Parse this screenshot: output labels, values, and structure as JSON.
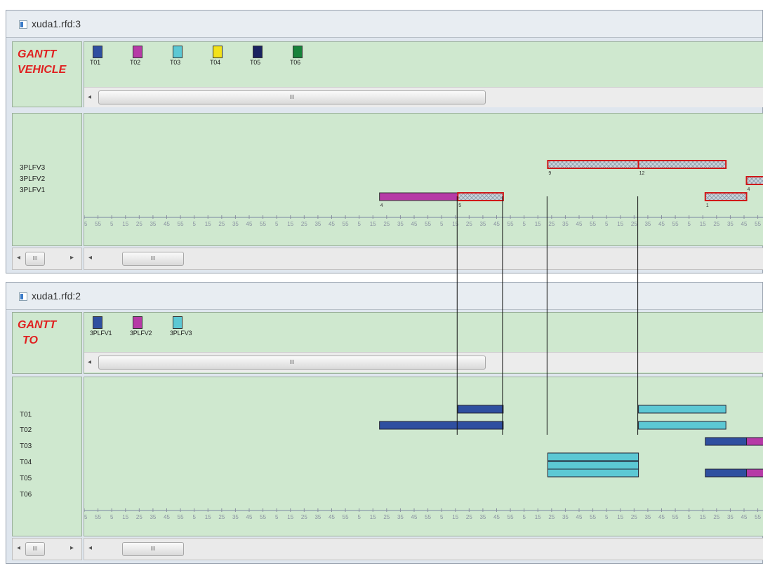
{
  "colors": {
    "T01": "#2f4fa0",
    "T02": "#b63aa6",
    "T03": "#5cc8d4",
    "T04": "#f2e21a",
    "T05": "#1a2260",
    "T06": "#17823a",
    "hatched_border": "#d01818",
    "hatched_fill": "#c9d4dc"
  },
  "top_window": {
    "title": "xuda1.rfd:3",
    "gantt_title_line1": "GANTT",
    "gantt_title_line2": "VEHICLE",
    "legend": [
      {
        "label": "T01",
        "color": "#2f4fa0"
      },
      {
        "label": "T02",
        "color": "#b63aa6"
      },
      {
        "label": "T03",
        "color": "#5cc8d4"
      },
      {
        "label": "T04",
        "color": "#f2e21a"
      },
      {
        "label": "T05",
        "color": "#1a2260"
      },
      {
        "label": "T06",
        "color": "#17823a"
      }
    ],
    "scroll_thumb_label": "III",
    "row_labels": [
      "3PLFV3",
      "3PLFV2",
      "3PLFV1"
    ]
  },
  "bottom_window": {
    "title": "xuda1.rfd:2",
    "gantt_title_line1": "GANTT",
    "gantt_title_line2": "TO",
    "legend": [
      {
        "label": "3PLFV1",
        "color": "#2f4fa0"
      },
      {
        "label": "3PLFV2",
        "color": "#b63aa6"
      },
      {
        "label": "3PLFV3",
        "color": "#5cc8d4"
      }
    ],
    "scroll_thumb_label": "III",
    "row_labels": [
      "T01",
      "T02",
      "T03",
      "T04",
      "T05",
      "T06"
    ]
  },
  "timeline": {
    "start_hour": 4.75,
    "end_hour": 13.0,
    "minute_ticks": [
      10,
      20,
      30,
      40,
      50
    ],
    "hours": [
      5,
      6,
      7,
      8,
      9,
      10,
      11,
      12
    ]
  },
  "vehicle_bars": [
    {
      "row": "3PLFV1",
      "start": 8.33,
      "end": 9.28,
      "style": "solid",
      "color": "#b63aa6",
      "num_start": "4",
      "num_end": "5",
      "hatch_from": 9.28
    },
    {
      "row": "3PLFV1",
      "start": 9.28,
      "end": 9.83,
      "style": "hatched"
    },
    {
      "row": "3PLFV3",
      "start": 10.37,
      "end": 11.47,
      "style": "hatched",
      "num_start": "9",
      "num_end": "12"
    },
    {
      "row": "3PLFV3",
      "start": 11.47,
      "end": 12.53,
      "style": "hatched"
    },
    {
      "row": "3PLFV1",
      "start": 12.28,
      "end": 12.78,
      "style": "hatched",
      "num_start": "1"
    },
    {
      "row": "3PLFV2",
      "start": 12.78,
      "end": 13.08,
      "style": "hatched",
      "num_start": "4"
    }
  ],
  "to_bars": [
    {
      "row": "T01",
      "start": 9.28,
      "end": 9.83,
      "color": "#2f4fa0"
    },
    {
      "row": "T02",
      "start": 8.33,
      "end": 9.83,
      "color": "#2f4fa0"
    },
    {
      "row": "T01",
      "start": 11.47,
      "end": 12.53,
      "color": "#5cc8d4"
    },
    {
      "row": "T02",
      "start": 11.47,
      "end": 12.53,
      "color": "#5cc8d4"
    },
    {
      "row": "T03",
      "start": 12.28,
      "end": 12.78,
      "color": "#2f4fa0"
    },
    {
      "row": "T03",
      "start": 12.78,
      "end": 13.08,
      "color": "#b63aa6"
    },
    {
      "row": "T04",
      "start": 10.37,
      "end": 11.47,
      "color": "#5cc8d4"
    },
    {
      "row": "T04b",
      "start": 10.37,
      "end": 11.47,
      "color": "#5cc8d4"
    },
    {
      "row": "T05",
      "start": 10.37,
      "end": 11.47,
      "color": "#5cc8d4"
    },
    {
      "row": "T05",
      "start": 12.28,
      "end": 12.78,
      "color": "#2f4fa0"
    },
    {
      "row": "T05",
      "start": 12.78,
      "end": 13.08,
      "color": "#b63aa6"
    }
  ]
}
